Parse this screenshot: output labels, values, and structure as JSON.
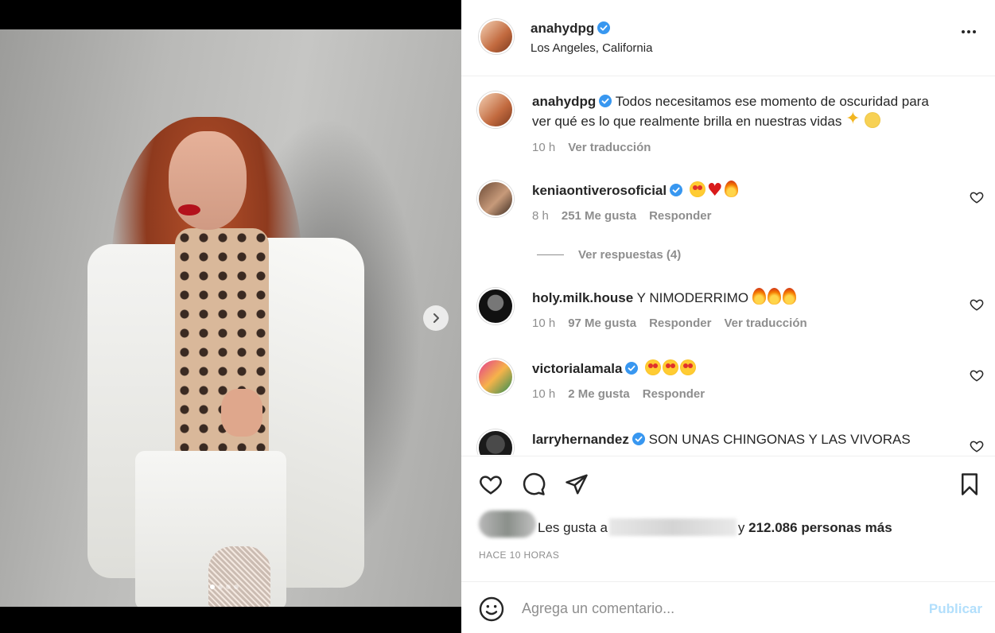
{
  "post": {
    "username": "anahydpg",
    "location": "Los Angeles, California",
    "caption": "Todos necesitamos ese momento de oscuridad para ver qué es lo que realmente brilla en nuestras vidas",
    "caption_time": "10 h",
    "see_translation": "Ver traducción"
  },
  "comments": [
    {
      "user": "keniaontiverosoficial",
      "verified": true,
      "text": "",
      "emojis": [
        "star-struck",
        "heart",
        "fire"
      ],
      "time": "8 h",
      "likes": "251 Me gusta",
      "reply": "Responder"
    },
    {
      "user": "holy.milk.house",
      "verified": false,
      "text": "Y NIMODERRIMO",
      "emojis": [
        "fire",
        "fire",
        "fire"
      ],
      "time": "10 h",
      "likes": "97 Me gusta",
      "reply": "Responder",
      "translate": "Ver traducción"
    },
    {
      "user": "victorialamala",
      "verified": true,
      "text": "",
      "emojis": [
        "star-struck",
        "star-struck",
        "star-struck"
      ],
      "time": "10 h",
      "likes": "2 Me gusta",
      "reply": "Responder"
    },
    {
      "user": "larryhernandez",
      "verified": true,
      "text": "SON UNAS CHINGONAS Y LAS VIVORAS"
    }
  ],
  "view_replies": "Ver respuestas (4)",
  "likes": {
    "prefix": "Les gusta a",
    "connector": "y",
    "count": "212.086 personas más"
  },
  "time_ago": "HACE 10 HORAS",
  "add_comment": {
    "placeholder": "Agrega un comentario...",
    "publish": "Publicar"
  },
  "carousel": {
    "slides": 4,
    "current": 1
  },
  "colors": {
    "accent": "#0095f6",
    "publish_disabled": "#b2dffc",
    "verified": "#3897f0"
  },
  "icons": [
    "heart-icon",
    "comment-icon",
    "share-icon",
    "bookmark-icon",
    "more-icon",
    "emoji-icon",
    "verified-icon",
    "next-arrow-icon"
  ]
}
